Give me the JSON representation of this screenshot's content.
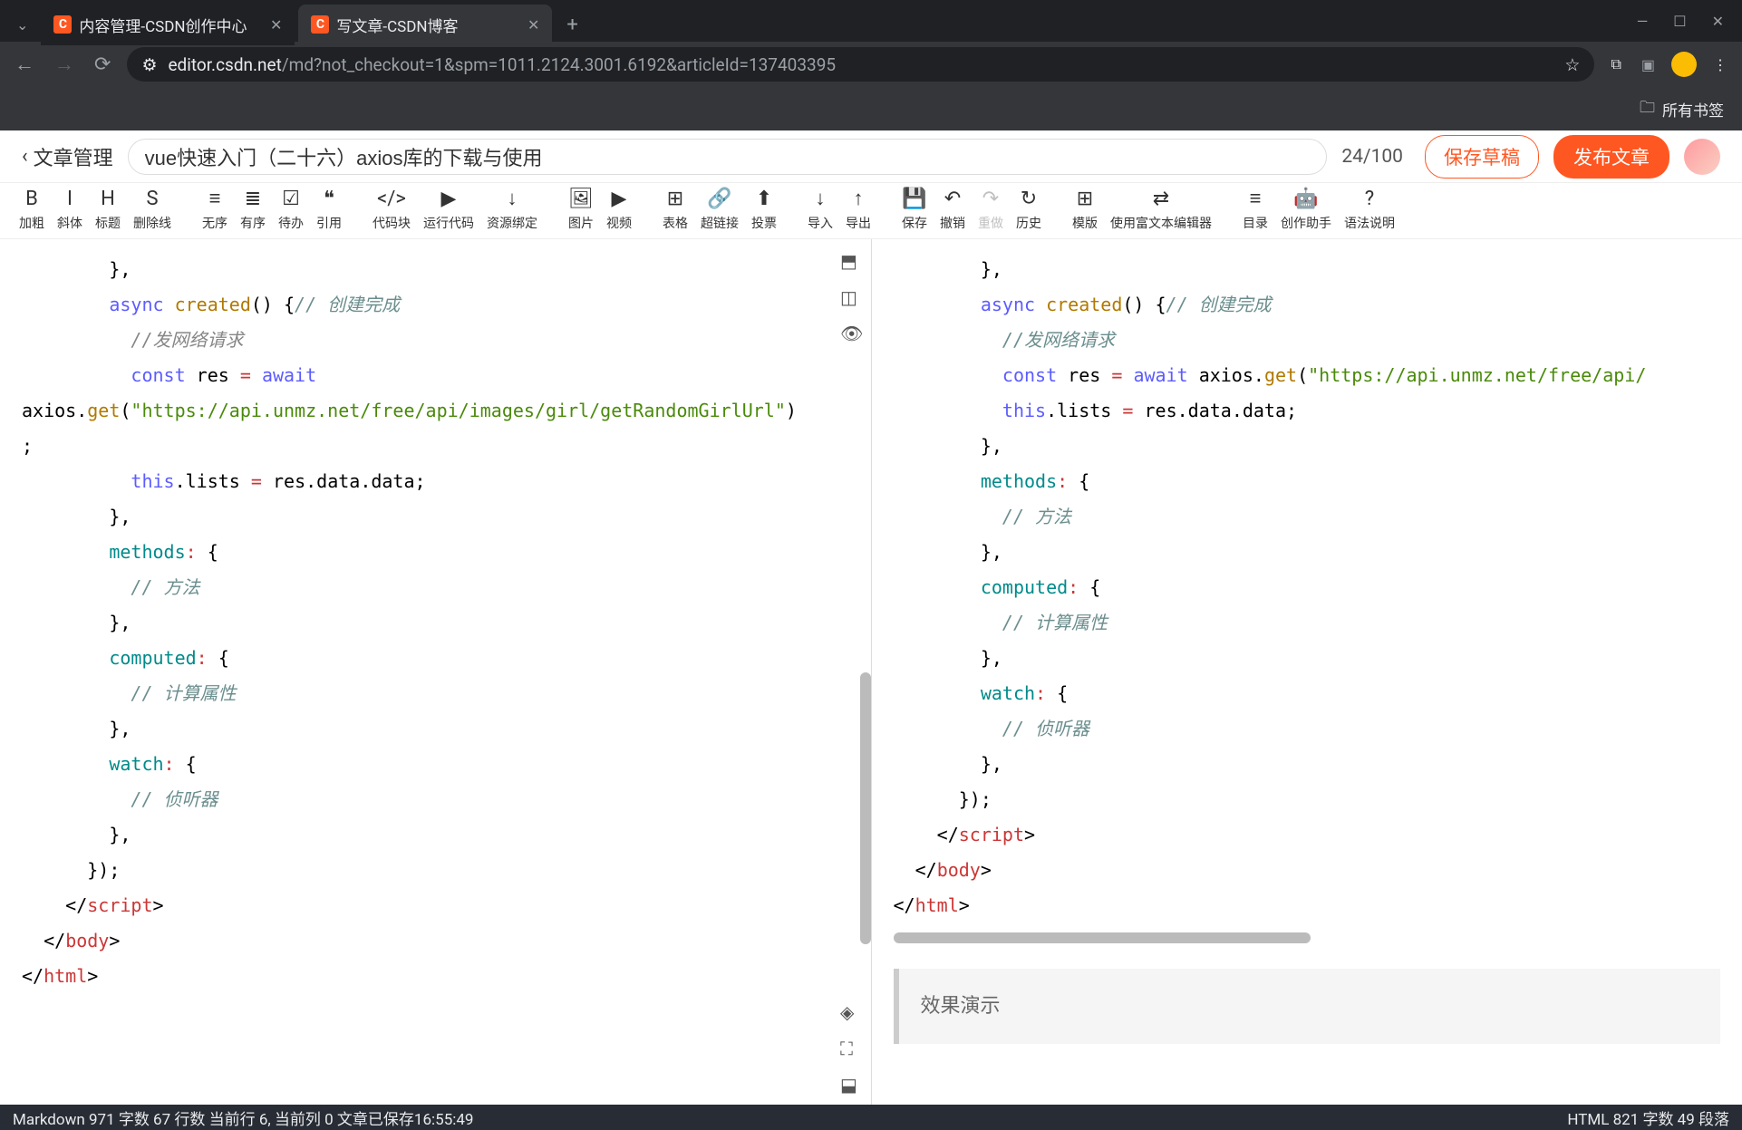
{
  "browser": {
    "tabs": [
      {
        "label": "内容管理-CSDN创作中心",
        "active": false
      },
      {
        "label": "写文章-CSDN博客",
        "active": true
      }
    ],
    "url_domain": "editor.csdn.net",
    "url_path": "/md?not_checkout=1&spm=1011.2124.3001.6192&articleId=137403395",
    "bookmarks_label": "所有书签"
  },
  "header": {
    "back_label": "文章管理",
    "title_value": "vue快速入门（二十六）axios库的下载与使用",
    "char_count": "24/100",
    "btn_draft": "保存草稿",
    "btn_publish": "发布文章"
  },
  "toolbar": [
    {
      "icon": "B",
      "label": "加粗",
      "name": "bold-button"
    },
    {
      "icon": "I",
      "label": "斜体",
      "name": "italic-button"
    },
    {
      "icon": "H",
      "label": "标题",
      "name": "heading-button"
    },
    {
      "icon": "S",
      "label": "删除线",
      "name": "strike-button"
    },
    {
      "sep": true
    },
    {
      "icon": "≡",
      "label": "无序",
      "name": "ul-button"
    },
    {
      "icon": "≣",
      "label": "有序",
      "name": "ol-button"
    },
    {
      "icon": "☑",
      "label": "待办",
      "name": "todo-button"
    },
    {
      "icon": "❝",
      "label": "引用",
      "name": "quote-button"
    },
    {
      "sep": true
    },
    {
      "icon": "</>",
      "label": "代码块",
      "name": "codeblock-button"
    },
    {
      "icon": "▶",
      "label": "运行代码",
      "name": "runcode-button"
    },
    {
      "icon": "↓",
      "label": "资源绑定",
      "name": "resource-button"
    },
    {
      "sep": true
    },
    {
      "icon": "🖼",
      "label": "图片",
      "name": "image-button"
    },
    {
      "icon": "▶",
      "label": "视频",
      "name": "video-button"
    },
    {
      "sep": true
    },
    {
      "icon": "⊞",
      "label": "表格",
      "name": "table-button"
    },
    {
      "icon": "🔗",
      "label": "超链接",
      "name": "link-button"
    },
    {
      "icon": "⬆",
      "label": "投票",
      "name": "vote-button"
    },
    {
      "sep": true
    },
    {
      "icon": "↓",
      "label": "导入",
      "name": "import-button"
    },
    {
      "icon": "↑",
      "label": "导出",
      "name": "export-button"
    },
    {
      "sep": true
    },
    {
      "icon": "💾",
      "label": "保存",
      "name": "save-button"
    },
    {
      "icon": "↶",
      "label": "撤销",
      "name": "undo-button"
    },
    {
      "icon": "↷",
      "label": "重做",
      "name": "redo-button",
      "dim": true
    },
    {
      "icon": "↻",
      "label": "历史",
      "name": "history-button"
    },
    {
      "sep": true
    },
    {
      "icon": "⊞",
      "label": "模版",
      "name": "template-button"
    },
    {
      "icon": "⇄",
      "label": "使用富文本编辑器",
      "name": "richtext-button"
    },
    {
      "sep": true
    },
    {
      "icon": "≡",
      "label": "目录",
      "name": "toc-button"
    },
    {
      "icon": "🤖",
      "label": "创作助手",
      "name": "assistant-button",
      "highlight": true
    },
    {
      "icon": "?",
      "label": "语法说明",
      "name": "syntax-button"
    }
  ],
  "left_code": [
    {
      "i": 4,
      "parts": [
        {
          "t": "},",
          "c": ""
        }
      ]
    },
    {
      "i": 4,
      "parts": [
        {
          "t": "async ",
          "c": "kw"
        },
        {
          "t": "created",
          "c": "fn"
        },
        {
          "t": "() {",
          "c": ""
        },
        {
          "t": "// 创建完成",
          "c": "com2"
        }
      ]
    },
    {
      "i": 5,
      "parts": [
        {
          "t": "//发网络请求",
          "c": "com"
        }
      ]
    },
    {
      "i": 5,
      "parts": [
        {
          "t": "const ",
          "c": "kw"
        },
        {
          "t": "res ",
          "c": ""
        },
        {
          "t": "= ",
          "c": "op"
        },
        {
          "t": "await",
          "c": "kw"
        }
      ]
    },
    {
      "i": 0,
      "parts": [
        {
          "t": "axios.",
          "c": ""
        },
        {
          "t": "get",
          "c": "fn"
        },
        {
          "t": "(",
          "c": ""
        },
        {
          "t": "\"https://api.unmz.net/free/api/images/girl/getRandomGirlUrl\"",
          "c": "str"
        },
        {
          "t": ")",
          "c": ""
        }
      ]
    },
    {
      "i": 0,
      "parts": [
        {
          "t": ";",
          "c": ""
        }
      ]
    },
    {
      "i": 5,
      "parts": [
        {
          "t": "this",
          "c": "kw"
        },
        {
          "t": ".lists ",
          "c": ""
        },
        {
          "t": "= ",
          "c": "op"
        },
        {
          "t": "res.data.data;",
          "c": ""
        }
      ]
    },
    {
      "i": 4,
      "parts": [
        {
          "t": "},",
          "c": ""
        }
      ]
    },
    {
      "i": 0,
      "parts": [
        {
          "t": "",
          "c": ""
        }
      ]
    },
    {
      "i": 4,
      "parts": [
        {
          "t": "methods",
          "c": "prop"
        },
        {
          "t": ":",
          "c": "op"
        },
        {
          "t": " {",
          "c": ""
        }
      ]
    },
    {
      "i": 5,
      "parts": [
        {
          "t": "// 方法",
          "c": "com2"
        }
      ]
    },
    {
      "i": 4,
      "parts": [
        {
          "t": "},",
          "c": ""
        }
      ]
    },
    {
      "i": 4,
      "parts": [
        {
          "t": "computed",
          "c": "prop"
        },
        {
          "t": ":",
          "c": "op"
        },
        {
          "t": " {",
          "c": ""
        }
      ]
    },
    {
      "i": 5,
      "parts": [
        {
          "t": "// 计算属性",
          "c": "com2"
        }
      ]
    },
    {
      "i": 4,
      "parts": [
        {
          "t": "},",
          "c": ""
        }
      ]
    },
    {
      "i": 4,
      "parts": [
        {
          "t": "watch",
          "c": "prop"
        },
        {
          "t": ":",
          "c": "op"
        },
        {
          "t": " {",
          "c": ""
        }
      ]
    },
    {
      "i": 5,
      "parts": [
        {
          "t": "// 侦听器",
          "c": "com2"
        }
      ]
    },
    {
      "i": 4,
      "parts": [
        {
          "t": "},",
          "c": ""
        }
      ]
    },
    {
      "i": 3,
      "parts": [
        {
          "t": "});",
          "c": ""
        }
      ]
    },
    {
      "i": 2,
      "parts": [
        {
          "t": "</",
          "c": ""
        },
        {
          "t": "script",
          "c": "tag"
        },
        {
          "t": ">",
          "c": ""
        }
      ]
    },
    {
      "i": 1,
      "parts": [
        {
          "t": "</",
          "c": ""
        },
        {
          "t": "body",
          "c": "tag"
        },
        {
          "t": ">",
          "c": ""
        }
      ]
    },
    {
      "i": 0,
      "parts": [
        {
          "t": "</",
          "c": ""
        },
        {
          "t": "html",
          "c": "tag"
        },
        {
          "t": ">",
          "c": ""
        }
      ]
    }
  ],
  "right_code": [
    {
      "i": 4,
      "parts": [
        {
          "t": "},",
          "c": ""
        }
      ]
    },
    {
      "i": 4,
      "parts": [
        {
          "t": "async ",
          "c": "kw"
        },
        {
          "t": "created",
          "c": "fn"
        },
        {
          "t": "() {",
          "c": ""
        },
        {
          "t": "// 创建完成",
          "c": "com2"
        }
      ]
    },
    {
      "i": 5,
      "parts": [
        {
          "t": "//发网络请求",
          "c": "com2"
        }
      ]
    },
    {
      "i": 5,
      "parts": [
        {
          "t": "const ",
          "c": "kw"
        },
        {
          "t": "res ",
          "c": ""
        },
        {
          "t": "= ",
          "c": "op"
        },
        {
          "t": "await ",
          "c": "kw"
        },
        {
          "t": "axios.",
          "c": ""
        },
        {
          "t": "get",
          "c": "fn"
        },
        {
          "t": "(",
          "c": ""
        },
        {
          "t": "\"https://api.unmz.net/free/api/",
          "c": "str"
        }
      ]
    },
    {
      "i": 5,
      "parts": [
        {
          "t": "this",
          "c": "kw"
        },
        {
          "t": ".lists ",
          "c": ""
        },
        {
          "t": "= ",
          "c": "op"
        },
        {
          "t": "res.data.data;",
          "c": ""
        }
      ]
    },
    {
      "i": 4,
      "parts": [
        {
          "t": "},",
          "c": ""
        }
      ]
    },
    {
      "i": 0,
      "parts": [
        {
          "t": "",
          "c": ""
        }
      ]
    },
    {
      "i": 4,
      "parts": [
        {
          "t": "methods",
          "c": "prop"
        },
        {
          "t": ":",
          "c": "op"
        },
        {
          "t": " {",
          "c": ""
        }
      ]
    },
    {
      "i": 5,
      "parts": [
        {
          "t": "// 方法",
          "c": "com2"
        }
      ]
    },
    {
      "i": 4,
      "parts": [
        {
          "t": "},",
          "c": ""
        }
      ]
    },
    {
      "i": 4,
      "parts": [
        {
          "t": "computed",
          "c": "prop"
        },
        {
          "t": ":",
          "c": "op"
        },
        {
          "t": " {",
          "c": ""
        }
      ]
    },
    {
      "i": 5,
      "parts": [
        {
          "t": "// 计算属性",
          "c": "com2"
        }
      ]
    },
    {
      "i": 4,
      "parts": [
        {
          "t": "},",
          "c": ""
        }
      ]
    },
    {
      "i": 4,
      "parts": [
        {
          "t": "watch",
          "c": "prop"
        },
        {
          "t": ":",
          "c": "op"
        },
        {
          "t": " {",
          "c": ""
        }
      ]
    },
    {
      "i": 5,
      "parts": [
        {
          "t": "// 侦听器",
          "c": "com2"
        }
      ]
    },
    {
      "i": 4,
      "parts": [
        {
          "t": "},",
          "c": ""
        }
      ]
    },
    {
      "i": 3,
      "parts": [
        {
          "t": "});",
          "c": ""
        }
      ]
    },
    {
      "i": 2,
      "parts": [
        {
          "t": "</",
          "c": ""
        },
        {
          "t": "script",
          "c": "tag"
        },
        {
          "t": ">",
          "c": ""
        }
      ]
    },
    {
      "i": 1,
      "parts": [
        {
          "t": "</",
          "c": ""
        },
        {
          "t": "body",
          "c": "tag"
        },
        {
          "t": ">",
          "c": ""
        }
      ]
    },
    {
      "i": 0,
      "parts": [
        {
          "t": "</",
          "c": ""
        },
        {
          "t": "html",
          "c": "tag"
        },
        {
          "t": ">",
          "c": ""
        }
      ]
    }
  ],
  "preview_heading": "效果演示",
  "status": {
    "left": "Markdown  971 字数  67 行数  当前行 6, 当前列 0  文章已保存16:55:49",
    "right": "HTML  821 字数  49 段落"
  }
}
